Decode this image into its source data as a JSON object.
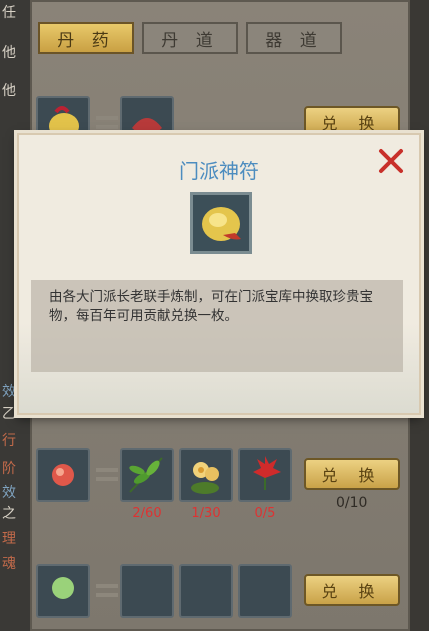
{
  "left_chars": [
    "任",
    "他",
    "他",
    "效",
    "乙",
    "行",
    "阶",
    "效",
    "之",
    "理",
    "魂"
  ],
  "tabs": [
    {
      "label": "丹 药",
      "active": true
    },
    {
      "label": "丹 道",
      "active": false
    },
    {
      "label": "器 道",
      "active": false
    }
  ],
  "rows": [
    {
      "button": "兑 换",
      "materials": []
    },
    {
      "button": "兑 换",
      "owned": "0/10",
      "materials": [
        {
          "name": "green-herb",
          "count": "2/60"
        },
        {
          "name": "golden-flower",
          "count": "1/30"
        },
        {
          "name": "red-flower",
          "count": "0/5"
        }
      ]
    },
    {
      "button": "兑 换",
      "materials": []
    }
  ],
  "dialog": {
    "title": "门派神符",
    "description": "由各大门派长老联手炼制，可在门派宝库中换取珍贵宝物，每百年可用贡献兑换一枚。",
    "item_icon": "gold-talisman-icon",
    "title_color": "#4c8cbf",
    "close_color": "#c8302a"
  }
}
